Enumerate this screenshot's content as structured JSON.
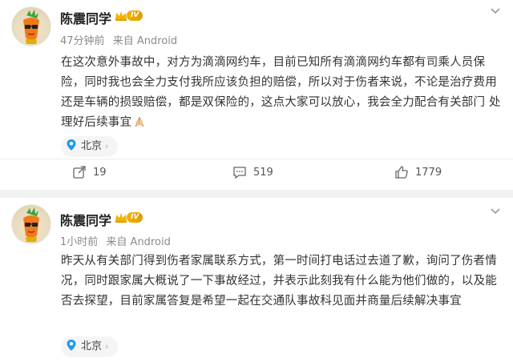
{
  "posts": [
    {
      "user_name": "陈震同学",
      "level_badge": "IV",
      "time": "47分钟前",
      "source": "来自 Android",
      "text": "在这次意外事故中，对方为滴滴网约车，目前已知所有滴滴网约车都有司乘人员保险，同时我也会全力支付我所应该负担的赔偿，所以对于伤者来说，不论是治疗费用还是车辆的损毁赔偿，都是双保险的，这点大家可以放心，我会全力配合有关部门 处理好后续事宜",
      "emoji": "pray-hands-icon",
      "location": "北京",
      "actions": {
        "reposts": "19",
        "comments": "519",
        "likes": "1779"
      }
    },
    {
      "user_name": "陈震同学",
      "level_badge": "IV",
      "time": "1小时前",
      "source": "来自 Android",
      "text": "昨天从有关部门得到伤者家属联系方式，第一时间打电话过去道了歉，询问了伤者情况，同时跟家属大概说了一下事故经过，并表示此刻我有什么能为他们做的，以及能否去探望，目前家属答复是希望一起在交通队事故科见面并商量后续解决事宜",
      "location": "北京"
    }
  ],
  "colors": {
    "badge": "#f0b400",
    "location_pin": "#1d9bf0",
    "text": "#333333",
    "meta": "#8a8a8a"
  }
}
